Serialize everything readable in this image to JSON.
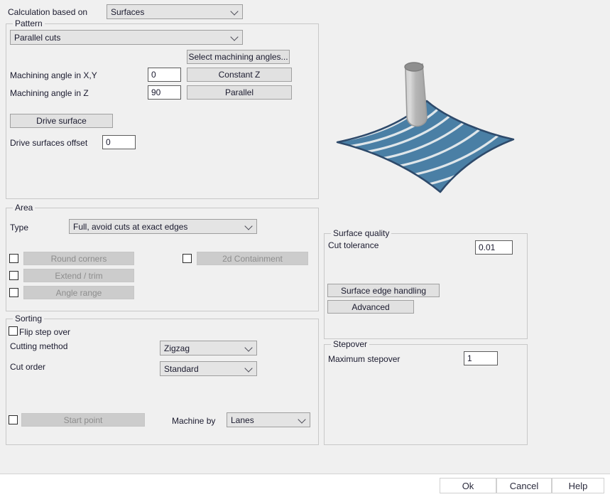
{
  "dialog": {
    "calculation_label": "Calculation based on",
    "calculation_value": "Surfaces"
  },
  "pattern": {
    "title": "Pattern",
    "pattern_value": "Parallel cuts",
    "select_angles_button": "Select machining angles...",
    "angle_xy_label": "Machining angle in X,Y",
    "angle_xy_value": "0",
    "constant_z_button": "Constant Z",
    "angle_z_label": "Machining angle in Z",
    "angle_z_value": "90",
    "parallel_button": "Parallel",
    "drive_surface_button": "Drive surface",
    "drive_offset_label": "Drive surfaces offset",
    "drive_offset_value": "0"
  },
  "area": {
    "title": "Area",
    "type_label": "Type",
    "type_value": "Full, avoid cuts at exact edges",
    "round_corners_button": "Round corners",
    "extend_trim_button": "Extend / trim",
    "angle_range_button": "Angle range",
    "containment_button": "2d Containment"
  },
  "sorting": {
    "title": "Sorting",
    "flip_step_over_label": "Flip step over",
    "cutting_method_label": "Cutting method",
    "cutting_method_value": "Zigzag",
    "cut_order_label": "Cut order",
    "cut_order_value": "Standard",
    "start_point_button": "Start point",
    "machine_by_label": "Machine by",
    "machine_by_value": "Lanes"
  },
  "surface_quality": {
    "title": "Surface quality",
    "cut_tolerance_label": "Cut tolerance",
    "cut_tolerance_value": "0.01",
    "edge_handling_button": "Surface edge handling",
    "advanced_button": "Advanced"
  },
  "stepover": {
    "title": "Stepover",
    "maximum_stepover_label": "Maximum stepover",
    "maximum_stepover_value": "1"
  },
  "footer": {
    "ok_button": "Ok",
    "cancel_button": "Cancel",
    "help_button": "Help"
  },
  "preview": {
    "surface_fill": "#4a7fa5",
    "surface_outline": "#2e4a6b",
    "toolpath_color": "#dfe6ea",
    "tool_body": "#b4b4b4",
    "tool_highlight": "#d6d6d6",
    "tool_top": "#8c8c8c"
  }
}
